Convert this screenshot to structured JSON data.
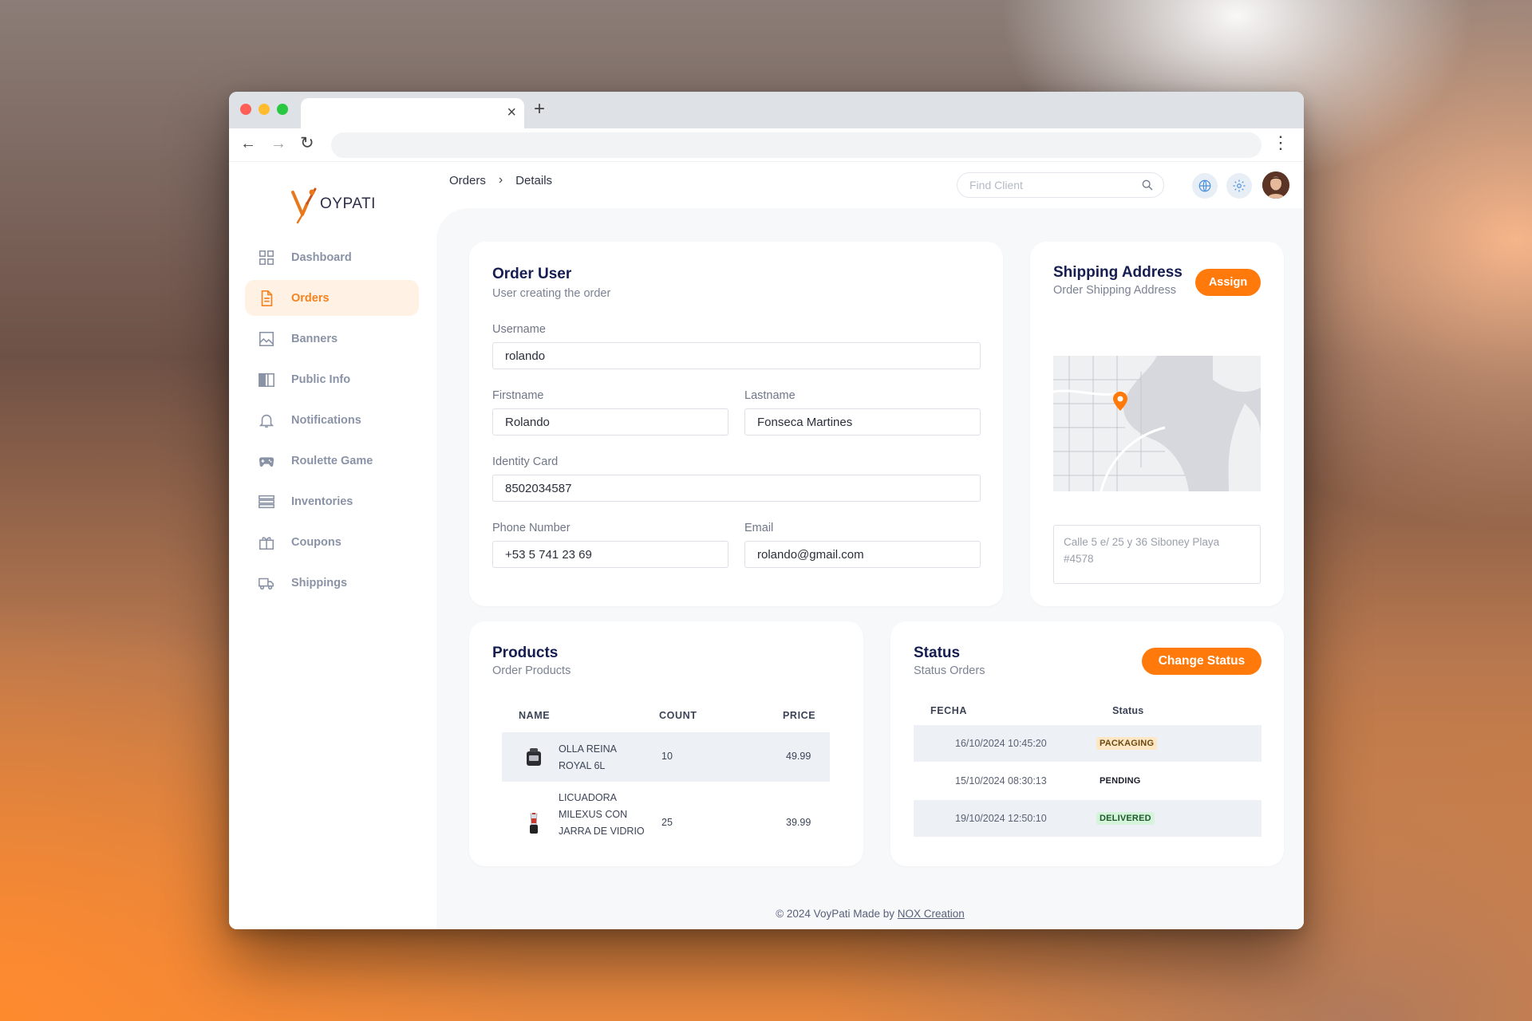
{
  "browser": {
    "tab_close": "×",
    "new_tab": "+",
    "back": "←",
    "forward": "→",
    "reload": "↻",
    "menu": "⋮"
  },
  "brand": {
    "name": "OYPATI",
    "accent": "#ff7a0a"
  },
  "sidebar": {
    "items": [
      {
        "label": "Dashboard",
        "icon": "dashboard-grid-icon"
      },
      {
        "label": "Orders",
        "icon": "document-icon",
        "active": true
      },
      {
        "label": "Banners",
        "icon": "image-icon"
      },
      {
        "label": "Public Info",
        "icon": "book-icon"
      },
      {
        "label": "Notifications",
        "icon": "bell-icon"
      },
      {
        "label": "Roulette Game",
        "icon": "gamepad-icon"
      },
      {
        "label": "Inventories",
        "icon": "list-icon"
      },
      {
        "label": "Coupons",
        "icon": "gift-icon"
      },
      {
        "label": "Shippings",
        "icon": "truck-icon"
      }
    ]
  },
  "header": {
    "breadcrumb": [
      "Orders",
      "Details"
    ],
    "breadcrumb_sep": "›",
    "search_placeholder": "Find Client"
  },
  "order_user": {
    "title": "Order User",
    "subtitle": "User creating the order",
    "username_label": "Username",
    "username": "rolando",
    "firstname_label": "Firstname",
    "firstname": "Rolando",
    "lastname_label": "Lastname",
    "lastname": "Fonseca Martines",
    "identity_label": "Identity Card",
    "identity": "8502034587",
    "phone_label": "Phone Number",
    "phone": "+53 5 741 23 69",
    "email_label": "Email",
    "email": "rolando@gmail.com"
  },
  "shipping": {
    "title": "Shipping Address",
    "subtitle": "Order Shipping Address",
    "assign_label": "Assign",
    "address_placeholder": "Calle 5 e/ 25 y 36 Siboney Playa #4578"
  },
  "products": {
    "title": "Products",
    "subtitle": "Order Products",
    "columns": [
      "NAME",
      "COUNT",
      "PRICE"
    ],
    "rows": [
      {
        "name_line1": "OLLA REINA",
        "name_line2": "ROYAL 6L",
        "count": "10",
        "price": "49.99",
        "icon": "pot-icon"
      },
      {
        "name_line1": "LICUADORA",
        "name_line2": "MILEXUS CON",
        "name_line3": "JARRA DE VIDRIO",
        "count": "25",
        "price": "39.99",
        "icon": "blender-icon"
      }
    ]
  },
  "status": {
    "title": "Status",
    "subtitle": "Status Orders",
    "change_label": "Change Status",
    "columns": [
      "FECHA",
      "Status"
    ],
    "rows": [
      {
        "date": "16/10/2024 10:45:20",
        "status": "PACKAGING",
        "color": "#fde7c4",
        "text_color": "#6b4a12"
      },
      {
        "date": "15/10/2024 08:30:13",
        "status": "PENDING",
        "color": "transparent",
        "text_color": "#1b1f2b"
      },
      {
        "date": "19/10/2024 12:50:10",
        "status": "DELIVERED",
        "color": "#d6f3dc",
        "text_color": "#1c5a2a"
      }
    ]
  },
  "footer": {
    "text": "© 2024 VoyPati Made by ",
    "link": "NOX Creation"
  }
}
